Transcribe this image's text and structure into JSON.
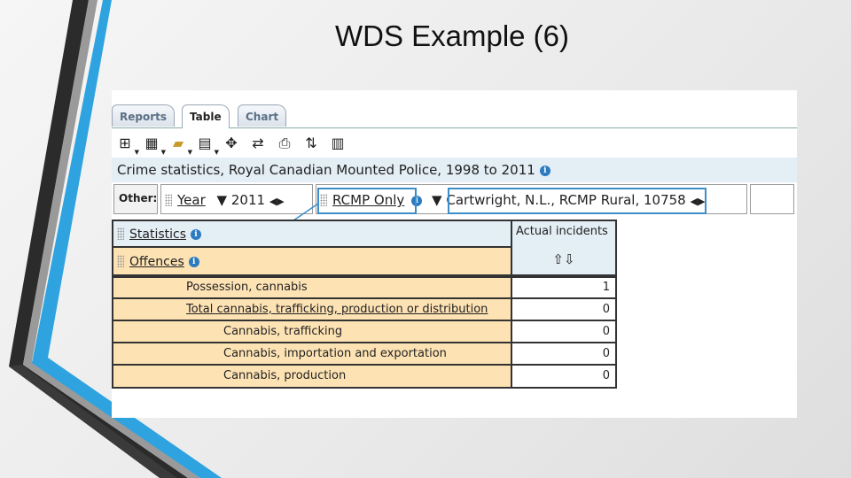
{
  "slide": {
    "title": "WDS Example (6)"
  },
  "colors": {
    "accent_blue": "#2fa3df",
    "dark_stripe": "#2b2b2b",
    "highlight": "#3c8dc8",
    "header_blue": "#e3eef5",
    "row_orange": "#fde2b4"
  },
  "tabs": [
    {
      "label": "Reports",
      "active": false
    },
    {
      "label": "Table",
      "active": true
    },
    {
      "label": "Chart",
      "active": false
    }
  ],
  "toolbar": {
    "icons": [
      {
        "name": "layout-icon",
        "glyph": "⊞"
      },
      {
        "name": "display-options-icon",
        "glyph": "▦"
      },
      {
        "name": "open-folder-icon",
        "glyph": "▰"
      },
      {
        "name": "calculator-icon",
        "glyph": "▤"
      },
      {
        "name": "move-icon",
        "glyph": "✥"
      },
      {
        "name": "swap-icon",
        "glyph": "⇄"
      },
      {
        "name": "print-icon",
        "glyph": "⎙"
      },
      {
        "name": "sort-icon",
        "glyph": "⇅"
      },
      {
        "name": "download-icon",
        "glyph": "▥"
      }
    ]
  },
  "table_title": "Crime statistics, Royal Canadian Mounted Police, 1998 to 2011",
  "other": {
    "label": "Other:",
    "year_label": "Year",
    "year_value": "2011",
    "rcmp_label": "RCMP Only",
    "location_value": "Cartwright, N.L., RCMP Rural, 10758",
    "arrows": "◀▶"
  },
  "grid": {
    "statistics_label": "Statistics",
    "offences_label": "Offences",
    "column_header": "Actual incidents",
    "sort_arrows": "⇧⇩",
    "rows": [
      {
        "label": "Possession, cannabis",
        "value": "1"
      },
      {
        "label": "Total cannabis, trafficking, production or distribution",
        "value": "0"
      },
      {
        "label": "Cannabis, trafficking",
        "value": "0"
      },
      {
        "label": "Cannabis, importation and exportation",
        "value": "0"
      },
      {
        "label": "Cannabis, production",
        "value": "0"
      }
    ]
  }
}
